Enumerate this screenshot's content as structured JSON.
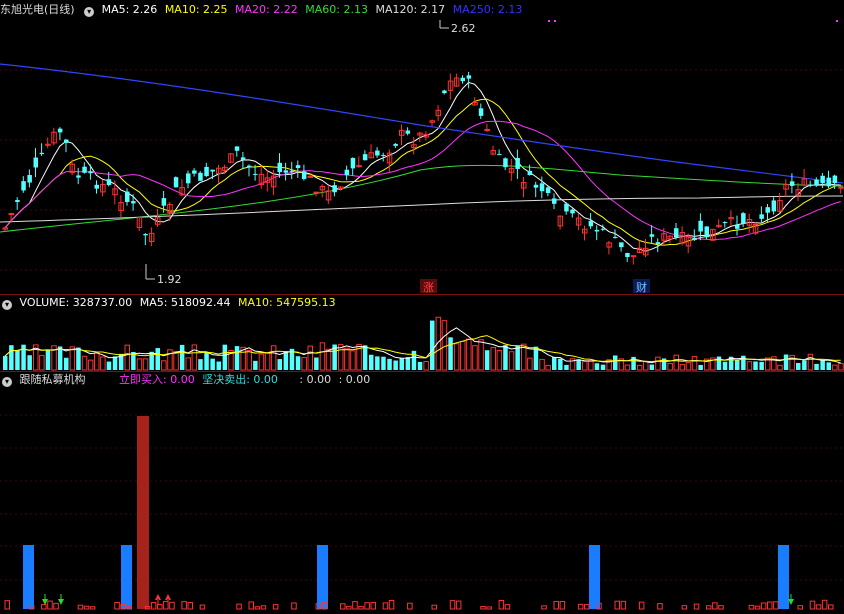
{
  "price_panel": {
    "stock_name": "东旭光电",
    "period": "(日线)",
    "ma": [
      {
        "label": "MA5: 2.26",
        "color": "#ffffff"
      },
      {
        "label": "MA10: 2.25",
        "color": "#ffff00"
      },
      {
        "label": "MA20: 2.22",
        "color": "#ff33ff"
      },
      {
        "label": "MA60: 2.13",
        "color": "#33dd33"
      },
      {
        "label": "MA120: 2.17",
        "color": "#dddddd"
      },
      {
        "label": "MA250: 2.13",
        "color": "#3333ff"
      }
    ],
    "high_label": "2.62",
    "low_label": "1.92",
    "mark_zhang": "涨",
    "mark_cai": "财"
  },
  "volume_panel": {
    "title": "VOLUME: 328737.00",
    "ma5": "MA5: 518092.44",
    "ma10": "MA10: 547595.13"
  },
  "indicator_panel": {
    "name": "跟随私募机构",
    "buy": "立即买入: 0.00",
    "sell": "坚决卖出: 0.00",
    "v3": ": 0.00",
    "v4": ": 0.00"
  },
  "colors": {
    "up": "#ff3232",
    "down": "#54ffff",
    "bg": "#000000"
  }
}
